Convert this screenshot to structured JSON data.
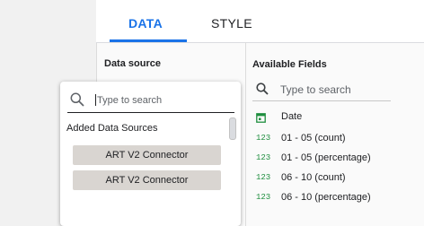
{
  "tabs": {
    "data": "DATA",
    "style": "STYLE"
  },
  "data_source": {
    "label": "Data source"
  },
  "available_fields": {
    "label": "Available Fields",
    "search_placeholder": "Type to search",
    "fields": [
      {
        "type": "",
        "icon": "calendar-icon",
        "name": "Date"
      },
      {
        "type": "123",
        "name": "01 - 05 (count)"
      },
      {
        "type": "123",
        "name": "01 - 05 (percentage)"
      },
      {
        "type": "123",
        "name": "06 - 10 (count)"
      },
      {
        "type": "123",
        "name": "06 - 10 (percentage)"
      }
    ]
  },
  "dropdown": {
    "search_placeholder": "Type to search",
    "heading": "Added Data Sources",
    "sources": [
      "ART V2 Connector",
      "ART V2 Connector"
    ]
  },
  "colors": {
    "accent": "#1a73e8",
    "number_type": "#1e8e3e",
    "chip": "#d9d5d1"
  }
}
